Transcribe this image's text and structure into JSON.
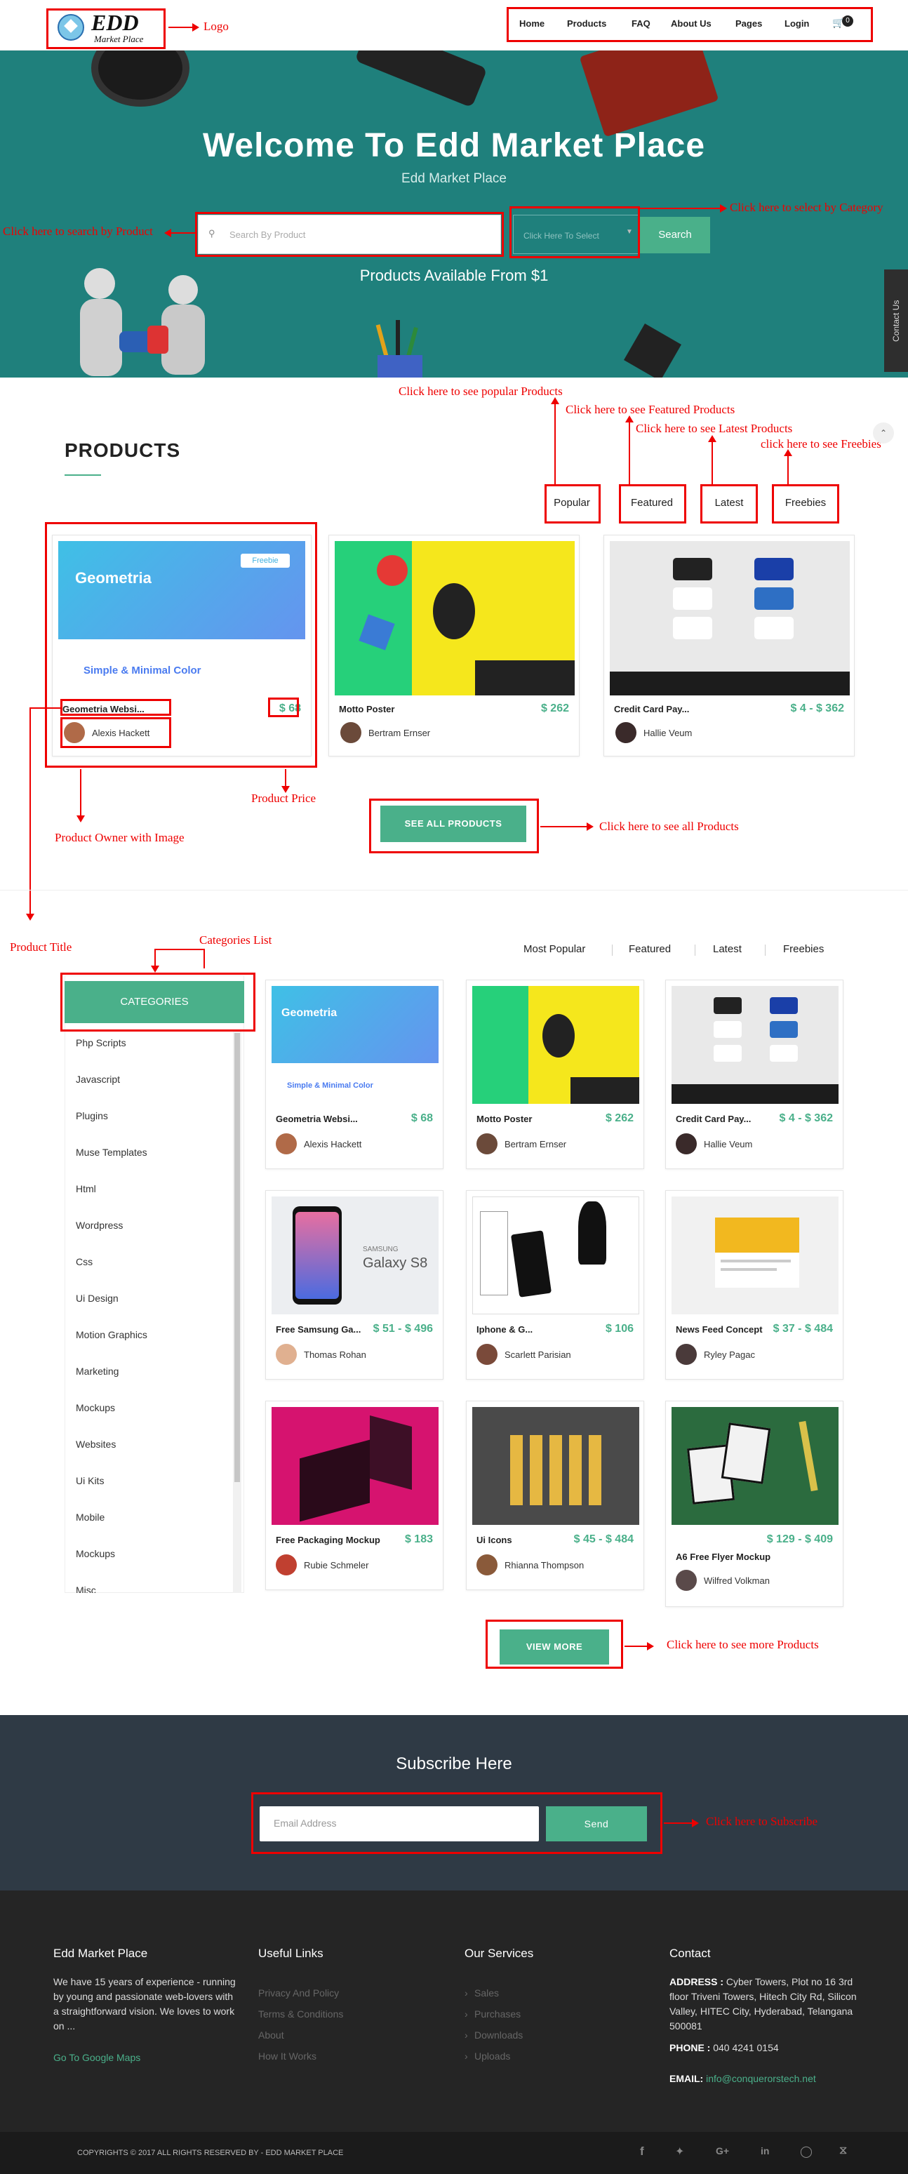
{
  "annotations": {
    "logo": "Logo",
    "search": "Click here to search by Product",
    "category": "Click here to select by Category",
    "popular": "Click here to see popular Products",
    "featured": "Click here to see Featured Products",
    "latest": "Click here to see Latest Products",
    "freebies": "click here to see Freebies",
    "price": "Product Price",
    "owner": "Product Owner with Image",
    "all": "Click here to see all Products",
    "title": "Product Title",
    "catlist": "Categories List",
    "more": "Click here to see more Products",
    "subscribe": "Click here to Subscribe"
  },
  "header": {
    "logo_main": "EDD",
    "logo_sub": "Market Place",
    "nav": [
      "Home",
      "Products",
      "FAQ",
      "About Us",
      "Pages",
      "Login"
    ],
    "cart_count": "0"
  },
  "hero": {
    "title": "Welcome To Edd Market Place",
    "subtitle": "Edd Market Place",
    "search_placeholder": "Search By Product",
    "category_placeholder": "Click Here To Select",
    "search_button": "Search",
    "available": "Products Available From $1",
    "contact_tab": "Contact Us"
  },
  "products": {
    "heading": "PRODUCTS",
    "tabs": [
      "Popular",
      "Featured",
      "Latest",
      "Freebies"
    ],
    "cards": [
      {
        "title": "Geometria Websi...",
        "price": "$ 68",
        "owner": "Alexis Hackett"
      },
      {
        "title": "Motto Poster",
        "price": "$ 262",
        "owner": "Bertram Ernser"
      },
      {
        "title": "Credit Card Pay...",
        "price": "$ 4 - $ 362",
        "owner": "Hallie Veum"
      }
    ],
    "see_all": "SEE ALL PRODUCTS"
  },
  "browse": {
    "tabs": [
      "Most Popular",
      "Featured",
      "Latest",
      "Freebies"
    ],
    "categories_heading": "CATEGORIES",
    "categories": [
      "Php Scripts",
      "Javascript",
      "Plugins",
      "Muse Templates",
      "Html",
      "Wordpress",
      "Css",
      "Ui Design",
      "Motion Graphics",
      "Marketing",
      "Mockups",
      "Websites",
      "Ui Kits",
      "Mobile",
      "Mockups",
      "Misc"
    ],
    "cards": [
      {
        "title": "Geometria Websi...",
        "price": "$ 68",
        "owner": "Alexis Hackett"
      },
      {
        "title": "Motto Poster",
        "price": "$ 262",
        "owner": "Bertram Ernser"
      },
      {
        "title": "Credit Card Pay...",
        "price": "$ 4 - $ 362",
        "owner": "Hallie Veum"
      },
      {
        "title": "Free Samsung Ga...",
        "price": "$ 51 - $ 496",
        "owner": "Thomas Rohan"
      },
      {
        "title": "Iphone & G...",
        "price": "$ 106",
        "owner": "Scarlett Parisian"
      },
      {
        "title": "News Feed Concept",
        "price": "$ 37 - $ 484",
        "owner": "Ryley Pagac"
      },
      {
        "title": "Free Packaging Mockup",
        "price": "$ 183",
        "owner": "Rubie Schmeler"
      },
      {
        "title": "Ui Icons",
        "price": "$ 45 - $ 484",
        "owner": "Rhianna Thompson"
      },
      {
        "title": "A6 Free Flyer Mockup",
        "price": "$ 129 - $ 409",
        "owner": "Wilfred Volkman"
      }
    ],
    "view_more": "VIEW MORE"
  },
  "subscribe": {
    "heading": "Subscribe Here",
    "placeholder": "Email Address",
    "button": "Send"
  },
  "footer": {
    "col1_title": "Edd Market Place",
    "col1_text": "We have 15 years of experience - running by young and passionate web-lovers with a straightforward vision. We loves to work on ...",
    "col1_link": "Go To Google Maps",
    "col2_title": "Useful Links",
    "col2_links": [
      "Privacy And Policy",
      "Terms & Conditions",
      "About",
      "How It Works"
    ],
    "col3_title": "Our Services",
    "col3_links": [
      "Sales",
      "Purchases",
      "Downloads",
      "Uploads"
    ],
    "col4_title": "Contact",
    "address_label": "ADDRESS :",
    "address": "Cyber Towers, Plot no 16 3rd floor Triveni Towers, Hitech City Rd, Silicon Valley, HITEC City, Hyderabad, Telangana 500081",
    "phone_label": "PHONE :",
    "phone": "040 4241 0154",
    "email_label": "EMAIL:",
    "email": "info@conquerorstech.net",
    "copyright": "COPYRIGHTS © 2017 ALL RIGHTS RESERVED BY - EDD MARKET PLACE"
  },
  "colors": {
    "accent": "#4ab08a",
    "hero": "#1f807c",
    "annotation": "#ee0000"
  }
}
